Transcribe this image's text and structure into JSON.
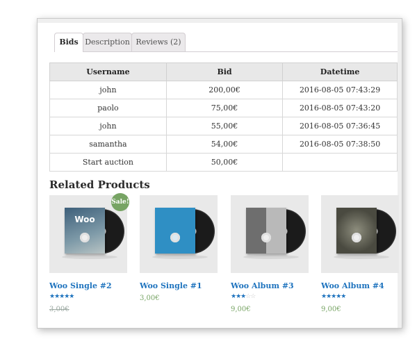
{
  "tabs": [
    {
      "label": "Bids",
      "active": true
    },
    {
      "label": "Description",
      "active": false
    },
    {
      "label": "Reviews (2)",
      "active": false
    }
  ],
  "table": {
    "headers": [
      "Username",
      "Bid",
      "Datetime"
    ],
    "rows": [
      [
        "john",
        "200,00€",
        "2016-08-05 07:43:29"
      ],
      [
        "paolo",
        "75,00€",
        "2016-08-05 07:43:20"
      ],
      [
        "john",
        "55,00€",
        "2016-08-05 07:36:45"
      ],
      [
        "samantha",
        "54,00€",
        "2016-08-05 07:38:50"
      ],
      [
        "Start auction",
        "50,00€",
        ""
      ]
    ]
  },
  "related": {
    "title": "Related Products",
    "products": [
      {
        "name": "Woo Single #2",
        "sleeve_text": "Woo",
        "sleeve_color": "#4a6f8a",
        "sale_badge": "Sale!",
        "rating": 4.5,
        "price": "3,00€",
        "price_struck": true
      },
      {
        "name": "Woo Single #1",
        "sleeve_text": "",
        "sleeve_color": "#2f8fc4",
        "sale_badge": "",
        "rating": 0,
        "price": "3,00€",
        "price_struck": false
      },
      {
        "name": "Woo Album #3",
        "sleeve_text": "",
        "sleeve_color": "#8d8d8d",
        "sale_badge": "",
        "rating": 3,
        "price": "9,00€",
        "price_struck": false
      },
      {
        "name": "Woo Album #4",
        "sleeve_text": "",
        "sleeve_color": "#5a5a4f",
        "sale_badge": "",
        "rating": 5,
        "price": "9,00€",
        "price_struck": false
      }
    ]
  },
  "colors": {
    "link": "#1e73be",
    "price": "#77a464",
    "sale_badge": "#77a464"
  }
}
